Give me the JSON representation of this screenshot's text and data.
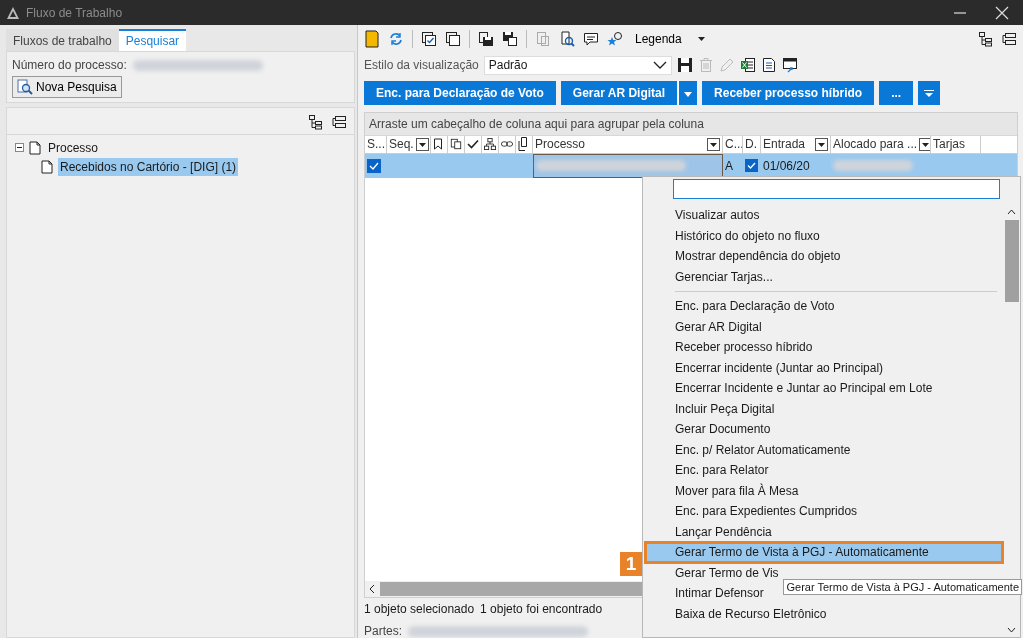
{
  "window": {
    "title": "Fluxo de Trabalho"
  },
  "left_panel": {
    "tabs": [
      {
        "label": "Fluxos de trabalho",
        "selected": false
      },
      {
        "label": "Pesquisar",
        "selected": true
      }
    ],
    "search_label": "Número do processo:",
    "search_button": "Nova Pesquisa",
    "tree": [
      {
        "label": "Processo",
        "expanded": true,
        "selected": false,
        "children": [
          {
            "label": "Recebidos no Cartório - [DIG] (1)",
            "selected": true
          }
        ]
      }
    ]
  },
  "toolbar": {
    "legend": "Legenda"
  },
  "view_style": {
    "label": "Estilo da visualização",
    "value": "Padrão"
  },
  "action_buttons": [
    {
      "label": "Enc. para Declaração de Voto",
      "kind": "button"
    },
    {
      "label": "Gerar AR Digital",
      "kind": "split"
    },
    {
      "label": "Receber processo híbrido",
      "kind": "button"
    },
    {
      "label": "...",
      "kind": "button"
    },
    {
      "kind": "menu"
    }
  ],
  "grid": {
    "group_hint": "Arraste um cabeçalho de coluna aqui para agrupar pela coluna",
    "columns": [
      {
        "kind": "text",
        "label": "S...",
        "filter": false
      },
      {
        "kind": "text",
        "label": "Seq.",
        "filter": true
      },
      {
        "kind": "icon"
      },
      {
        "kind": "icon"
      },
      {
        "kind": "icon"
      },
      {
        "kind": "icon"
      },
      {
        "kind": "icon"
      },
      {
        "kind": "icon"
      },
      {
        "kind": "text",
        "label": "Processo",
        "filter": true
      },
      {
        "kind": "text",
        "label": "C...",
        "filter": false
      },
      {
        "kind": "text",
        "label": "D.",
        "filter": false
      },
      {
        "kind": "text",
        "label": "Entrada",
        "filter": true
      },
      {
        "kind": "text",
        "label": "Alocado para ...",
        "filter": true
      },
      {
        "kind": "text",
        "label": "Tarjas",
        "filter": false
      }
    ],
    "rows": [
      {
        "selected": true,
        "checked": true,
        "c": "A",
        "d_checked": true,
        "entrada": "01/06/20"
      }
    ]
  },
  "status": {
    "selected_count": "1 objeto selecionado",
    "found_count": "1 objeto foi encontrado",
    "parties_label": "Partes:"
  },
  "context_menu": {
    "groups": [
      [
        {
          "label": "Visualizar autos",
          "selected": false
        },
        {
          "label": "Histórico do objeto no fluxo",
          "selected": false
        },
        {
          "label": "Mostrar dependência do objeto",
          "selected": false
        },
        {
          "label": "Gerenciar Tarjas...",
          "selected": false
        }
      ],
      [
        {
          "label": "Enc. para Declaração de Voto",
          "selected": false
        },
        {
          "label": "Gerar AR Digital",
          "selected": false
        },
        {
          "label": "Receber processo híbrido",
          "selected": false
        },
        {
          "label": "Encerrar incidente (Juntar ao Principal)",
          "selected": false
        },
        {
          "label": "Encerrar Incidente e Juntar ao Principal em Lote",
          "selected": false
        },
        {
          "label": "Incluir Peça Digital",
          "selected": false
        },
        {
          "label": "Gerar Documento",
          "selected": false
        },
        {
          "label": "Enc. p/ Relator Automaticamente",
          "selected": false
        },
        {
          "label": "Enc. para Relator",
          "selected": false
        },
        {
          "label": "Mover para fila À Mesa",
          "selected": false
        },
        {
          "label": "Enc. para Expedientes Cumpridos",
          "selected": false
        },
        {
          "label": "Lançar Pendência",
          "selected": false
        },
        {
          "label": "Gerar Termo de Vista à PGJ - Automaticamente",
          "selected": true
        },
        {
          "label": "Gerar Termo de Vis",
          "selected": false
        },
        {
          "label": "Intimar Defensor",
          "selected": false
        },
        {
          "label": "Baixa de Recurso Eletrônico",
          "selected": false
        }
      ]
    ]
  },
  "tooltip": "Gerar Termo de Vista à PGJ - Automaticamente",
  "annotation": "1"
}
